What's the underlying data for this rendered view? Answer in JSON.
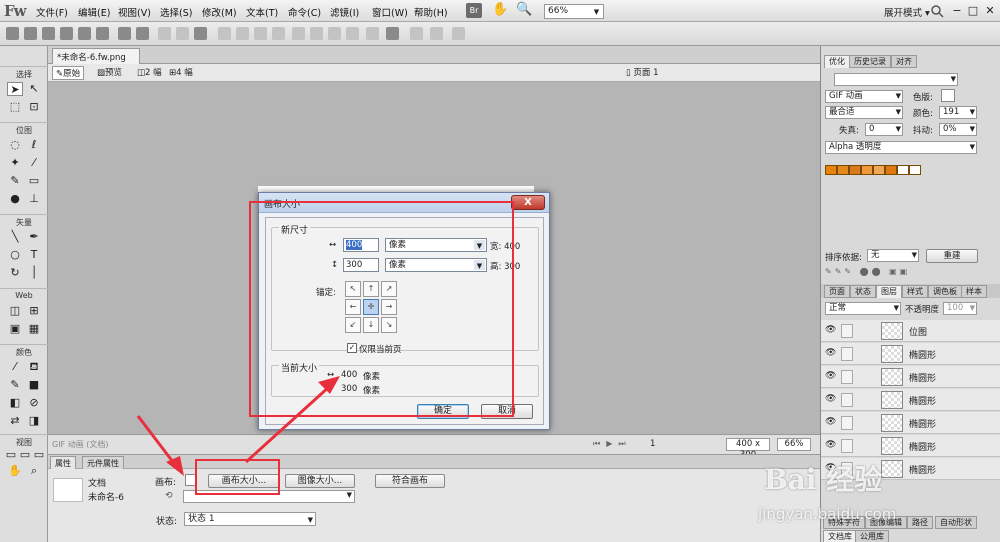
{
  "app": {
    "logo": "Fw"
  },
  "menu": [
    "文件(F)",
    "编辑(E)",
    "视图(V)",
    "选择(S)",
    "修改(M)",
    "文本(T)",
    "命令(C)",
    "滤镜(I)",
    "窗口(W)",
    "帮助(H)"
  ],
  "header": {
    "bridge_label": "Br",
    "zoom": "66%",
    "workspace_mode": "展开模式 ▾"
  },
  "tools": {
    "sections": [
      "选择",
      "位图",
      "矢量",
      "Web",
      "颜色",
      "视图"
    ]
  },
  "document": {
    "tab_label": "*未命名-6.fw.png",
    "views": [
      "原始",
      "预览",
      "2 幅",
      "4 幅"
    ],
    "page": "页面 1"
  },
  "status": {
    "doc_type": "GIF 动画 (文档)",
    "page_number": "1",
    "size": "400 x 300",
    "zoom": "66%"
  },
  "props": {
    "tabs": [
      "属性",
      "元件属性"
    ],
    "doc_label": "文档",
    "doc_name": "未命名-6",
    "canvas_label": "画布:",
    "canvas_size_button": "画布大小...",
    "image_size_button": "图像大小...",
    "fit_canvas_button": "符合画布",
    "state_label": "状态:",
    "state_value": "状态 1"
  },
  "right_panel": {
    "tabs": [
      "优化",
      "历史记录",
      "对齐"
    ],
    "format": "GIF 动画",
    "palette": "最合适",
    "matte_label": "色版:",
    "colors_label": "颜色:",
    "colors_value": "191",
    "loss_label": "失真:",
    "loss_value": "0",
    "dither_label": "抖动:",
    "dither_value": "0%",
    "transparency": "Alpha 透明度",
    "swatch_colors": [
      "#e8820a",
      "#e48a1a",
      "#d9791c",
      "#ef9a3a",
      "#f0a854",
      "#e07810",
      "#ffffff",
      "#ffffff"
    ],
    "sort_label": "排序依据:",
    "sort_value": "无",
    "rebuild_button": "重建",
    "layer_tabs": [
      "页面",
      "状态",
      "图层",
      "样式",
      "调色板",
      "样本"
    ],
    "blend_mode": "正常",
    "opacity_label": "不透明度",
    "opacity_value": "100",
    "layers": [
      "位图",
      "椭圆形",
      "椭圆形",
      "椭圆形",
      "椭圆形",
      "椭圆形",
      "椭圆形"
    ],
    "bottom_tabs_1": [
      "特殊字符",
      "图像编辑",
      "路径",
      "自动形状"
    ],
    "bottom_tabs_2": [
      "文档库",
      "公用库"
    ]
  },
  "dialog": {
    "title": "画布大小",
    "close_label": "X",
    "new_size_label": "新尺寸",
    "width_value": "400",
    "height_value": "300",
    "unit": "像素",
    "width_suffix": "宽: 400",
    "height_suffix": "高: 300",
    "anchor_label": "锚定:",
    "current_page_only": "仅限当前页",
    "current_size_label": "当前大小",
    "current_width": "400",
    "current_height": "300",
    "current_unit": "像素",
    "ok_button": "确定",
    "cancel_button": "取消"
  },
  "watermark": {
    "brand": "Bai 经验",
    "url": "jingyan.baidu.com"
  },
  "annotation_color": "#e8303c"
}
